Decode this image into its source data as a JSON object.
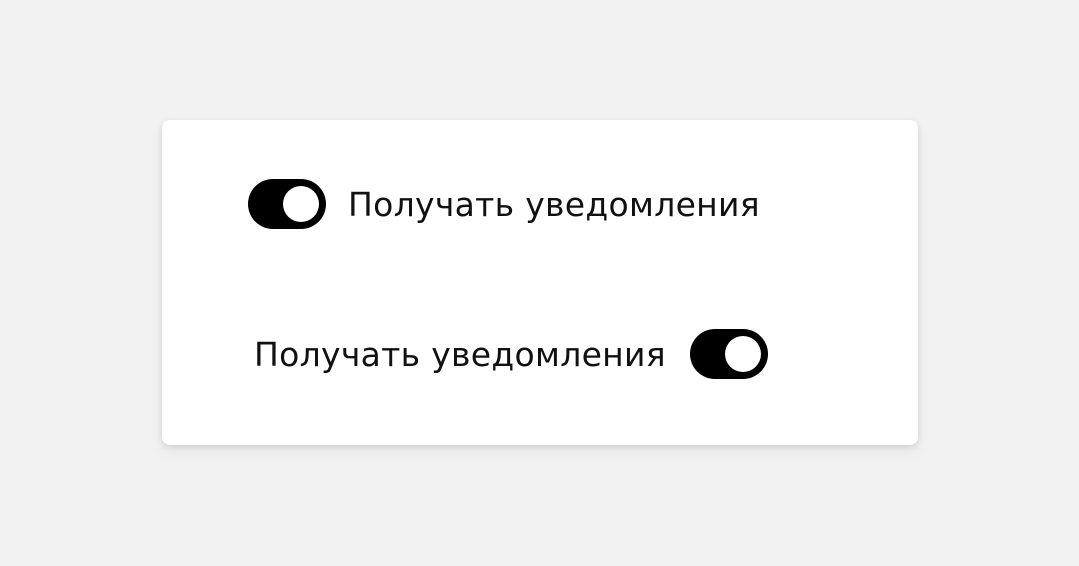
{
  "settings": {
    "option_1": {
      "label": "Получать уведомления",
      "toggle_state": "on"
    },
    "option_2": {
      "label": "Получать уведомления",
      "toggle_state": "on"
    }
  },
  "colors": {
    "background": "#f2f2f2",
    "card": "#ffffff",
    "toggle_on": "#000000",
    "knob": "#ffffff",
    "text": "#111111"
  }
}
